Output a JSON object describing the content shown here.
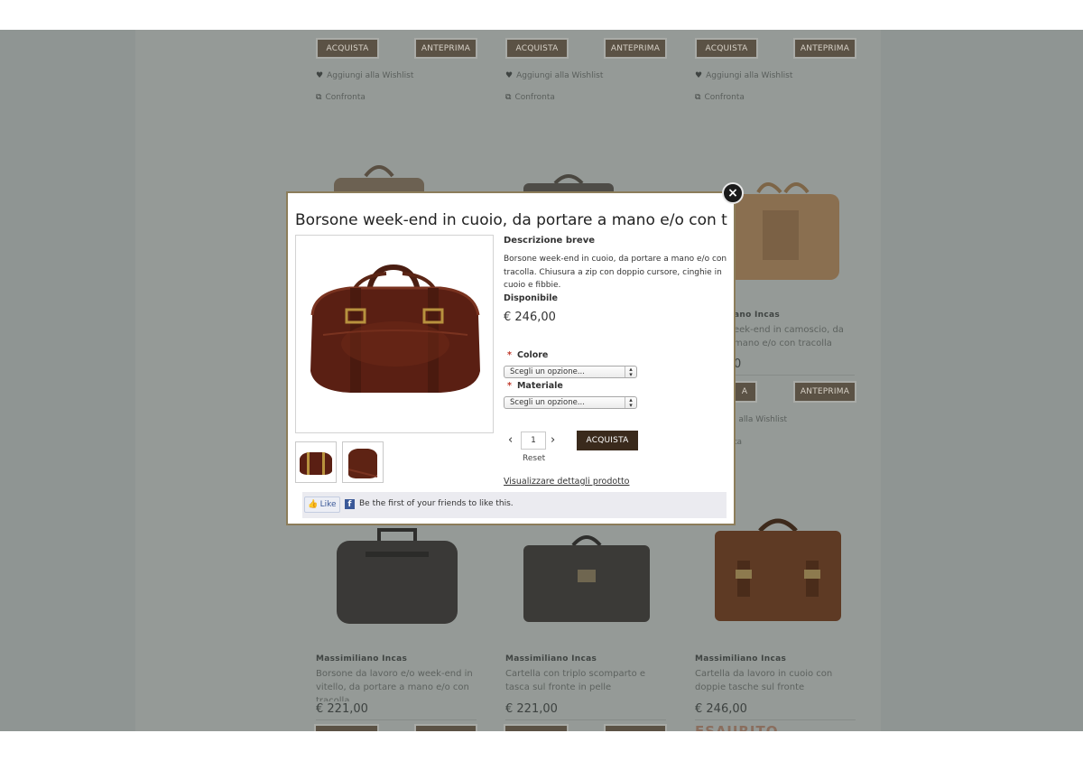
{
  "background": {
    "columns": [
      {
        "top_buy": "ACQUISTA",
        "top_preview": "ANTEPRIMA",
        "wishlist": "Aggiungi alla Wishlist",
        "compare": "Confronta",
        "brand": "Massimiliano Incas",
        "desc": "Borsone da lavoro e/o week-end in vitello, da portare a mano e/o con tracolla",
        "price": "€ 221,00"
      },
      {
        "top_buy": "ACQUISTA",
        "top_preview": "ANTEPRIMA",
        "wishlist": "Aggiungi alla Wishlist",
        "compare": "Confronta",
        "brand": "Massimiliano Incas",
        "desc": "Cartella con triplo scomparto e tasca sul fronte in pelle",
        "price": "€ 221,00"
      },
      {
        "top_buy": "ACQUISTA",
        "top_preview": "ANTEPRIMA",
        "wishlist": "Aggiungi alla Wishlist",
        "compare": "Confronta",
        "mid_brand": "ano Incas",
        "mid_desc": "eek-end in camoscio, da\nmano e/o con tracolla",
        "mid_price": "0",
        "mid_buy": "A",
        "mid_preview": "ANTEPRIMA",
        "mid_wishlist": "i alla Wishlist",
        "mid_compare": "ta",
        "brand": "Massimiliano Incas",
        "desc": "Cartella da lavoro in cuoio con doppie tasche sul fronte",
        "price": "€ 246,00",
        "status": "ESAURITO"
      }
    ]
  },
  "modal": {
    "title": "Borsone week-end in cuoio, da portare a mano e/o con tracolla",
    "short_desc_label": "Descrizione breve",
    "short_desc": "Borsone week-end in cuoio, da portare a mano e/o con tracolla. Chiusura a zip con doppio cursore, cinghie in cuoio e fibbie.",
    "availability": "Disponibile",
    "price": "€ 246,00",
    "color_label": "Colore",
    "color_select": "Scegli un opzione...",
    "material_label": "Materiale",
    "material_select": "Scegli un opzione...",
    "required_mark": "*",
    "quantity": "1",
    "reset": "Reset",
    "buy": "ACQUISTA",
    "details_link": "Visualizzare dettagli prodotto",
    "close": "×",
    "facebook": {
      "like": "Like",
      "text": "Be the first of your friends to like this."
    }
  },
  "colors": {
    "overlay": "#8f9593",
    "modal_border": "#8c7d5a",
    "buy_button": "#3a2a1c",
    "facebook": "#3b5998"
  },
  "icons": [
    "heart-icon",
    "compare-icon",
    "close-icon",
    "chevron-left-icon",
    "chevron-right-icon",
    "thumbs-up-icon",
    "facebook-icon",
    "select-arrows-icon"
  ]
}
